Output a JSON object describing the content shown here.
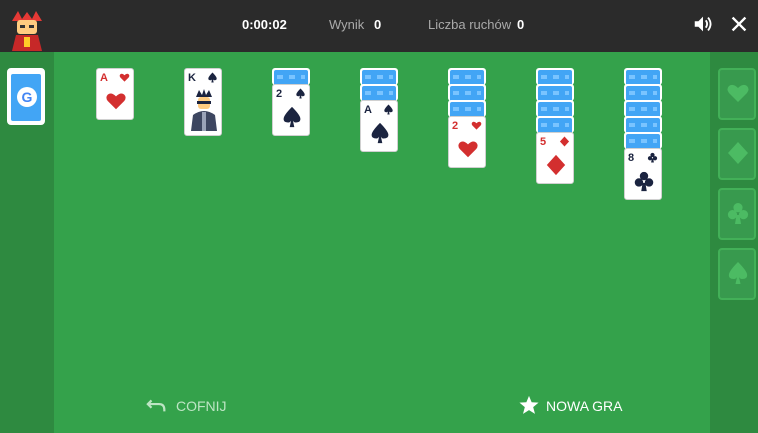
{
  "header": {
    "timer": "0:00:02",
    "score_label": "Wynik",
    "score_value": "0",
    "moves_label": "Liczba ruchów",
    "moves_value": "0"
  },
  "stock": {
    "logo": "G"
  },
  "tableau": [
    {
      "face_down": 0,
      "top": {
        "rank": "A",
        "suit": "heart",
        "color": "red"
      }
    },
    {
      "face_down": 0,
      "top": {
        "rank": "K",
        "suit": "spade",
        "color": "black"
      }
    },
    {
      "face_down": 1,
      "top": {
        "rank": "2",
        "suit": "spade",
        "color": "black"
      }
    },
    {
      "face_down": 2,
      "top": {
        "rank": "A",
        "suit": "spade",
        "color": "black"
      }
    },
    {
      "face_down": 3,
      "top": {
        "rank": "2",
        "suit": "heart",
        "color": "red"
      }
    },
    {
      "face_down": 4,
      "top": {
        "rank": "5",
        "suit": "diamond",
        "color": "red"
      }
    },
    {
      "face_down": 5,
      "top": {
        "rank": "8",
        "suit": "club",
        "color": "black"
      }
    }
  ],
  "foundations": [
    "heart",
    "diamond",
    "club",
    "spade"
  ],
  "actions": {
    "undo_label": "COFNIJ",
    "new_game_label": "NOWA GRA"
  },
  "colors": {
    "table": "#34a24b",
    "topbar": "#2b2b2b",
    "card_back": "#42a5f5",
    "red_suit": "#d32f2f",
    "black_suit": "#1b2440"
  }
}
